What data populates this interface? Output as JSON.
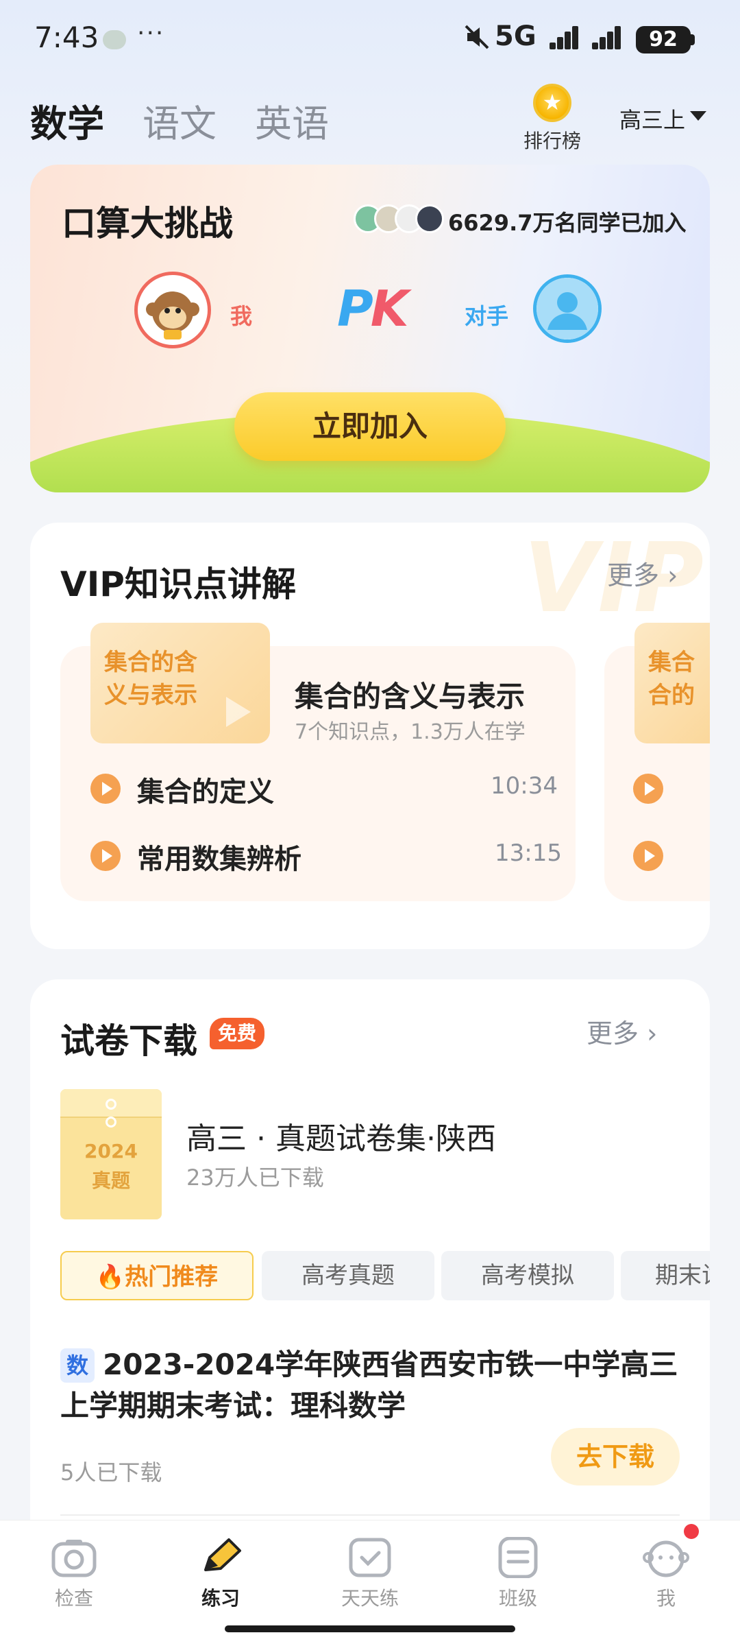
{
  "status": {
    "time": "7:43",
    "network": "5G",
    "battery": "92"
  },
  "header": {
    "tabs": [
      {
        "label": "数学",
        "active": true
      },
      {
        "label": "语文",
        "active": false
      },
      {
        "label": "英语",
        "active": false
      }
    ],
    "rank_label": "排行榜",
    "grade": "高三上"
  },
  "challenge": {
    "title": "口算大挑战",
    "joined": "6629.7万名同学已加入",
    "me_label": "我",
    "vs_p": "P",
    "vs_k": "K",
    "opponent_label": "对手",
    "join_button": "立即加入"
  },
  "vip": {
    "title": "VIP知识点讲解",
    "more": "更多",
    "watermark": "VIP",
    "course": {
      "thumb_line1": "集合的含",
      "thumb_line2": "义与表示",
      "title": "集合的含义与表示",
      "subtitle": "7个知识点，1.3万人在学",
      "lessons": [
        {
          "title": "集合的定义",
          "time": "10:34"
        },
        {
          "title": "常用数集辨析",
          "time": "13:15"
        }
      ]
    },
    "course2": {
      "thumb_line1": "集合",
      "thumb_line2": "合的"
    }
  },
  "papers": {
    "title": "试卷下载",
    "badge": "免费",
    "more": "更多",
    "featured": {
      "cover_year": "2024",
      "cover_label": "真题",
      "title": "高三 · 真题试卷集·陕西",
      "downloads": "23万人已下载"
    },
    "chips": [
      {
        "label": "热门推荐",
        "active": true
      },
      {
        "label": "高考真题",
        "active": false
      },
      {
        "label": "高考模拟",
        "active": false
      },
      {
        "label": "期末试",
        "active": false
      }
    ],
    "item": {
      "subject_tag": "数",
      "title": "2023-2024学年陕西省西安市铁一中学高三上学期期末考试：理科数学",
      "downloads": "5人已下载",
      "button": "去下载"
    }
  },
  "nav": [
    {
      "label": "检查",
      "icon": "camera-icon",
      "active": false
    },
    {
      "label": "练习",
      "icon": "pencil-icon",
      "active": true
    },
    {
      "label": "天天练",
      "icon": "calendar-check-icon",
      "active": false
    },
    {
      "label": "班级",
      "icon": "class-list-icon",
      "active": false
    },
    {
      "label": "我",
      "icon": "profile-face-icon",
      "active": false
    }
  ]
}
